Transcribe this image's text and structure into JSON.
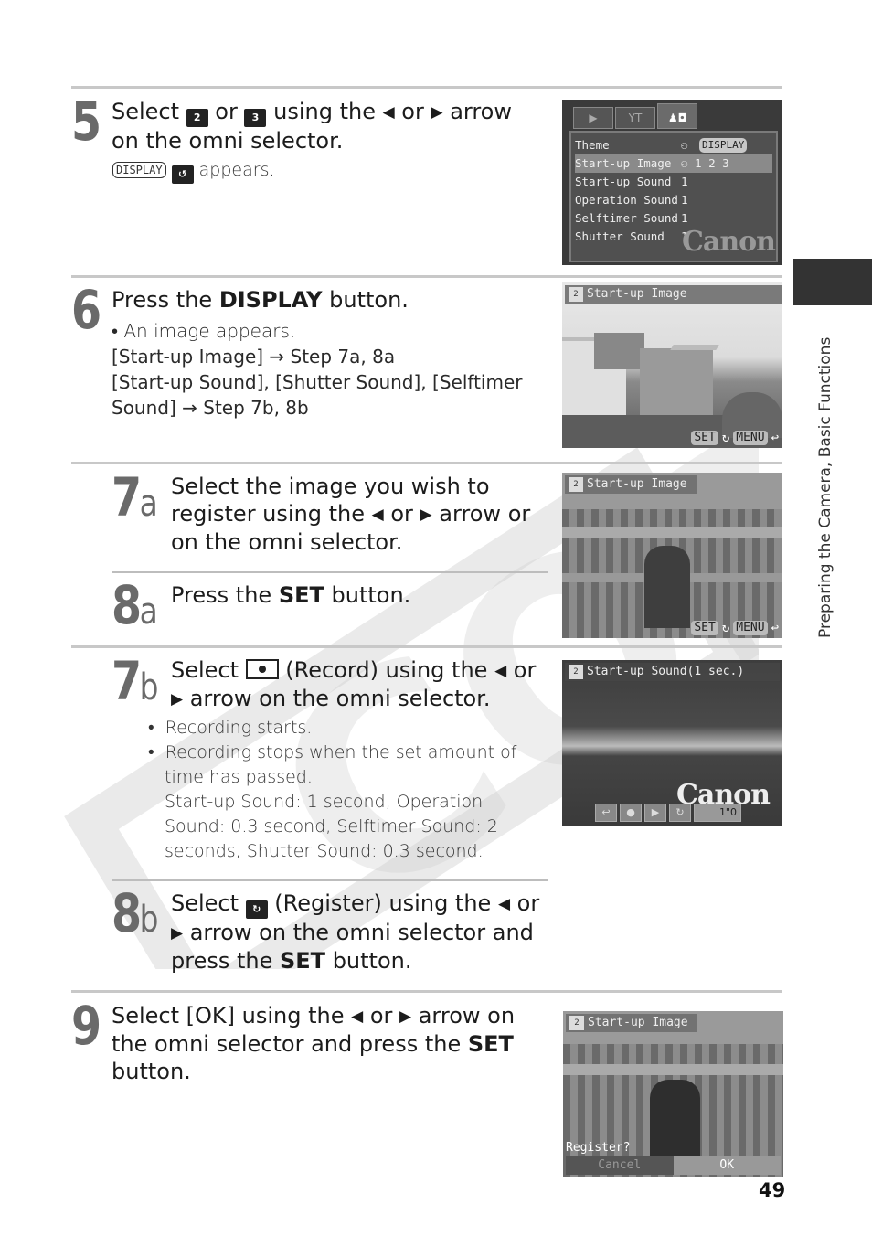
{
  "side_tab": {
    "label": "Preparing the Camera, Basic Functions"
  },
  "page_number": "49",
  "watermark": "COPY",
  "steps": {
    "s5": {
      "number": "5",
      "title_parts": [
        "Select ",
        " or ",
        " using the ",
        " or ",
        " arrow on the omni selector."
      ],
      "icon1": "2",
      "icon2": "3",
      "note_suffix": " appears.",
      "note_key": "DISPLAY"
    },
    "s6": {
      "number": "6",
      "title_pre": "Press the ",
      "title_bold": "DISPLAY",
      "title_post": " button.",
      "bullet": "• An image appears.",
      "line1": "[Start-up Image] → Step 7a, 8a",
      "line2": "[Start-up Sound], [Shutter Sound], [Selftimer Sound] → Step 7b, 8b"
    },
    "s7a": {
      "number": "7",
      "sub": "a",
      "title_pre": "Select the image you wish to register using the ",
      "title_mid": " or ",
      "title_post": " arrow or on the omni selector."
    },
    "s8a": {
      "number": "8",
      "sub": "a",
      "title_pre": "Press the ",
      "title_bold": "SET",
      "title_post": " button."
    },
    "s7b": {
      "number": "7",
      "sub": "b",
      "title_pre": "Select ",
      "title_mid": " (Record) using the ",
      "title_or": " or ",
      "title_post": " arrow on the omni selector.",
      "bullets": [
        "Recording starts.",
        "Recording stops when the set amount of time has passed."
      ],
      "detail": "Start-up Sound: 1 second, Operation Sound: 0.3 second, Selftimer Sound: 2 seconds, Shutter Sound: 0.3 second."
    },
    "s8b": {
      "number": "8",
      "sub": "b",
      "title_pre": "Select ",
      "title_mid": " (Register) using the ",
      "title_or": " or ",
      "title_post1": " arrow on the omni selector and press the ",
      "title_bold": "SET",
      "title_post2": " button."
    },
    "s9": {
      "number": "9",
      "title_pre": "Select [OK] using the ",
      "title_or": " or ",
      "title_post1": " arrow on the omni selector and press the ",
      "title_bold": "SET",
      "title_post2": " button."
    }
  },
  "screens": {
    "menu": {
      "tabs": [
        "▶",
        "YT",
        "♟◘"
      ],
      "rows": [
        {
          "label": "Theme",
          "value": "⚇",
          "extra": "DISPLAY"
        },
        {
          "label": "Start-up Image",
          "value": "⚇ 1 2 3"
        },
        {
          "label": "Start-up Sound",
          "value": "1"
        },
        {
          "label": "Operation Sound",
          "value": "1"
        },
        {
          "label": "Selftimer Sound",
          "value": "1"
        },
        {
          "label": "Shutter Sound",
          "value": "1"
        }
      ],
      "brand": "Canon"
    },
    "image1": {
      "title": "Start-up Image",
      "set": "SET",
      "menu": "MENU"
    },
    "image2": {
      "title": "Start-up Image",
      "set": "SET",
      "menu": "MENU"
    },
    "sound": {
      "title": "Start-up Sound(1 sec.)",
      "time": "1\"0",
      "brand": "Canon"
    },
    "register": {
      "title": "Start-up Image",
      "prompt": "Register?",
      "cancel": "Cancel",
      "ok": "OK"
    }
  }
}
